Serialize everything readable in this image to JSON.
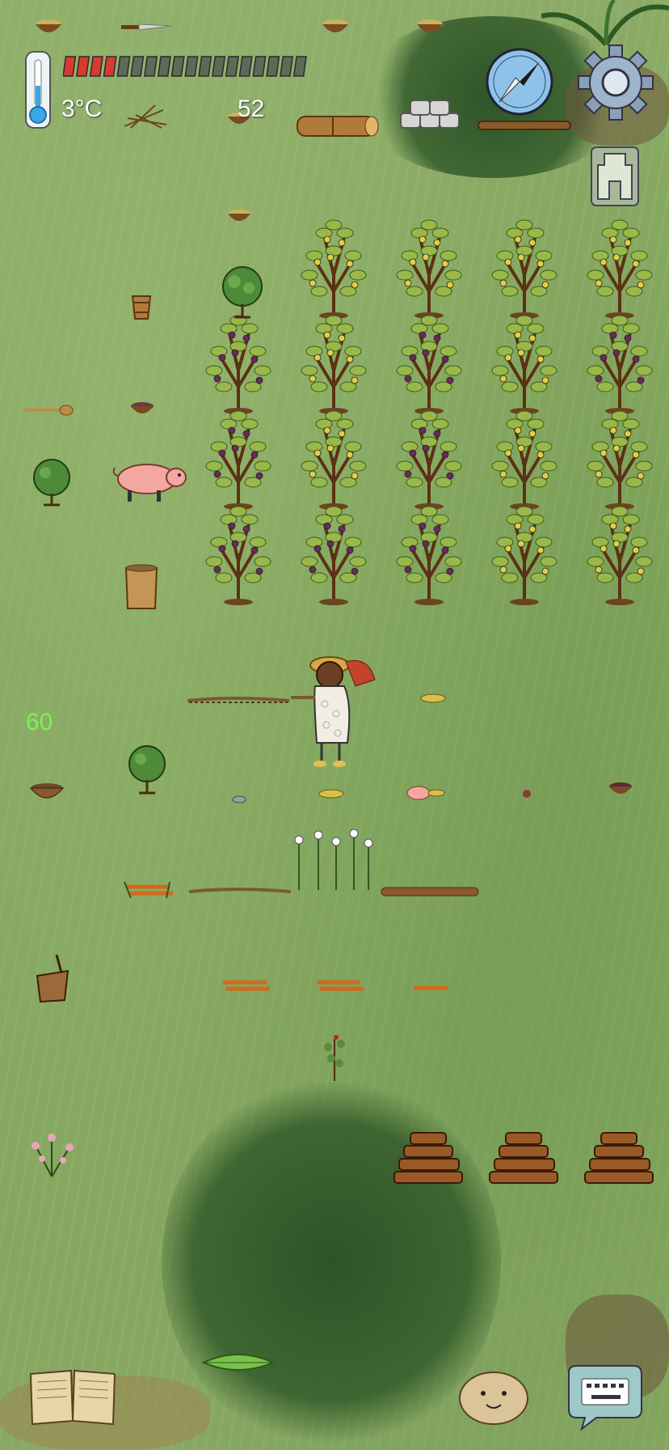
{
  "hud": {
    "temperature": "3°C",
    "food_count": "52",
    "hunger_filled_segments": 4,
    "hunger_total_segments": 18,
    "age_label": "60"
  },
  "icons": {
    "thermometer": "thermometer-icon",
    "settings": "gear-icon",
    "compass": "compass-icon",
    "family_tree": "family-tree-icon",
    "recipe_book": "book-icon",
    "emote": "emote-face-icon",
    "chat": "keyboard-chat-icon"
  },
  "colors": {
    "hunger_fill": "#d83a32",
    "hunger_empty": "#5d6a5a",
    "age_text": "#7ef05a",
    "grass": "#7ea259"
  }
}
